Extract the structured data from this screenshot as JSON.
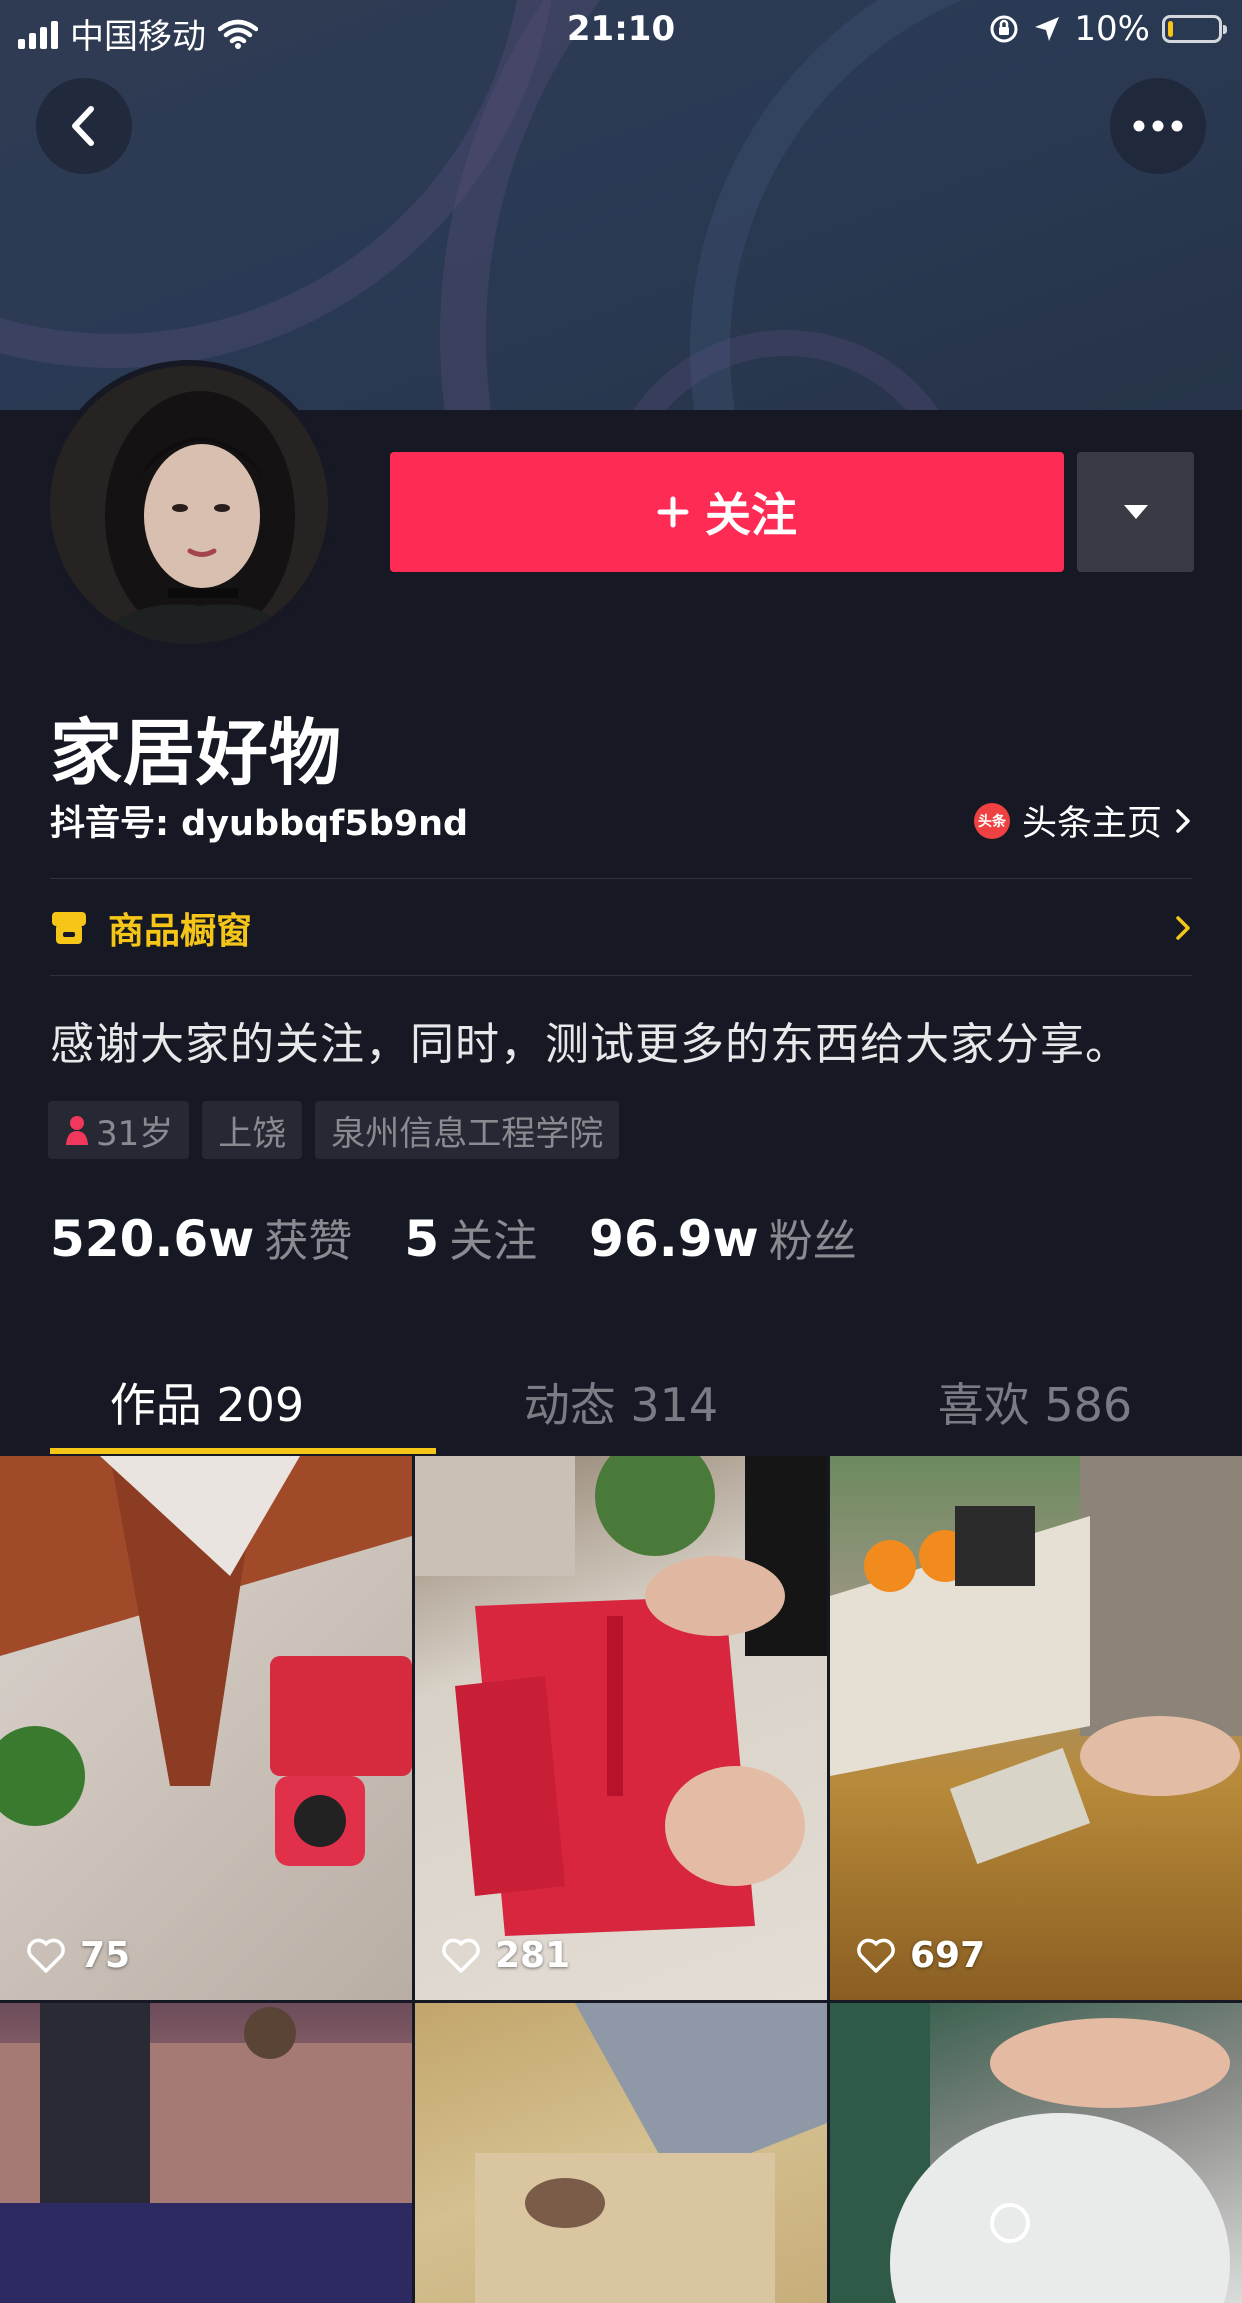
{
  "status_bar": {
    "carrier": "中国移动",
    "time": "21:10",
    "battery": "10%",
    "battery_level": 0.1
  },
  "profile": {
    "follow_label": "关注",
    "nickname": "家居好物",
    "douyin_id": "抖音号: dyubbqf5b9nd",
    "toutiao_label": "头条主页",
    "toutiao_logo_text": "头条",
    "shop_label": "商品橱窗",
    "bio": "感谢大家的关注，同时，测试更多的东西给大家分享。",
    "tags": {
      "age": "31岁",
      "city": "上饶",
      "school": "泉州信息工程学院"
    },
    "stats": {
      "likes_num": "520.6w",
      "likes_label": "获赞",
      "following_num": "5",
      "following_label": "关注",
      "fans_num": "96.9w",
      "fans_label": "粉丝"
    }
  },
  "tabs": [
    {
      "label": "作品 209"
    },
    {
      "label": "动态 314"
    },
    {
      "label": "喜欢 586"
    }
  ],
  "videos": [
    {
      "likes": "75"
    },
    {
      "likes": "281"
    },
    {
      "likes": "697"
    }
  ],
  "colors": {
    "accent": "#fe2c55",
    "background": "#161823",
    "highlight": "#f5c518"
  }
}
